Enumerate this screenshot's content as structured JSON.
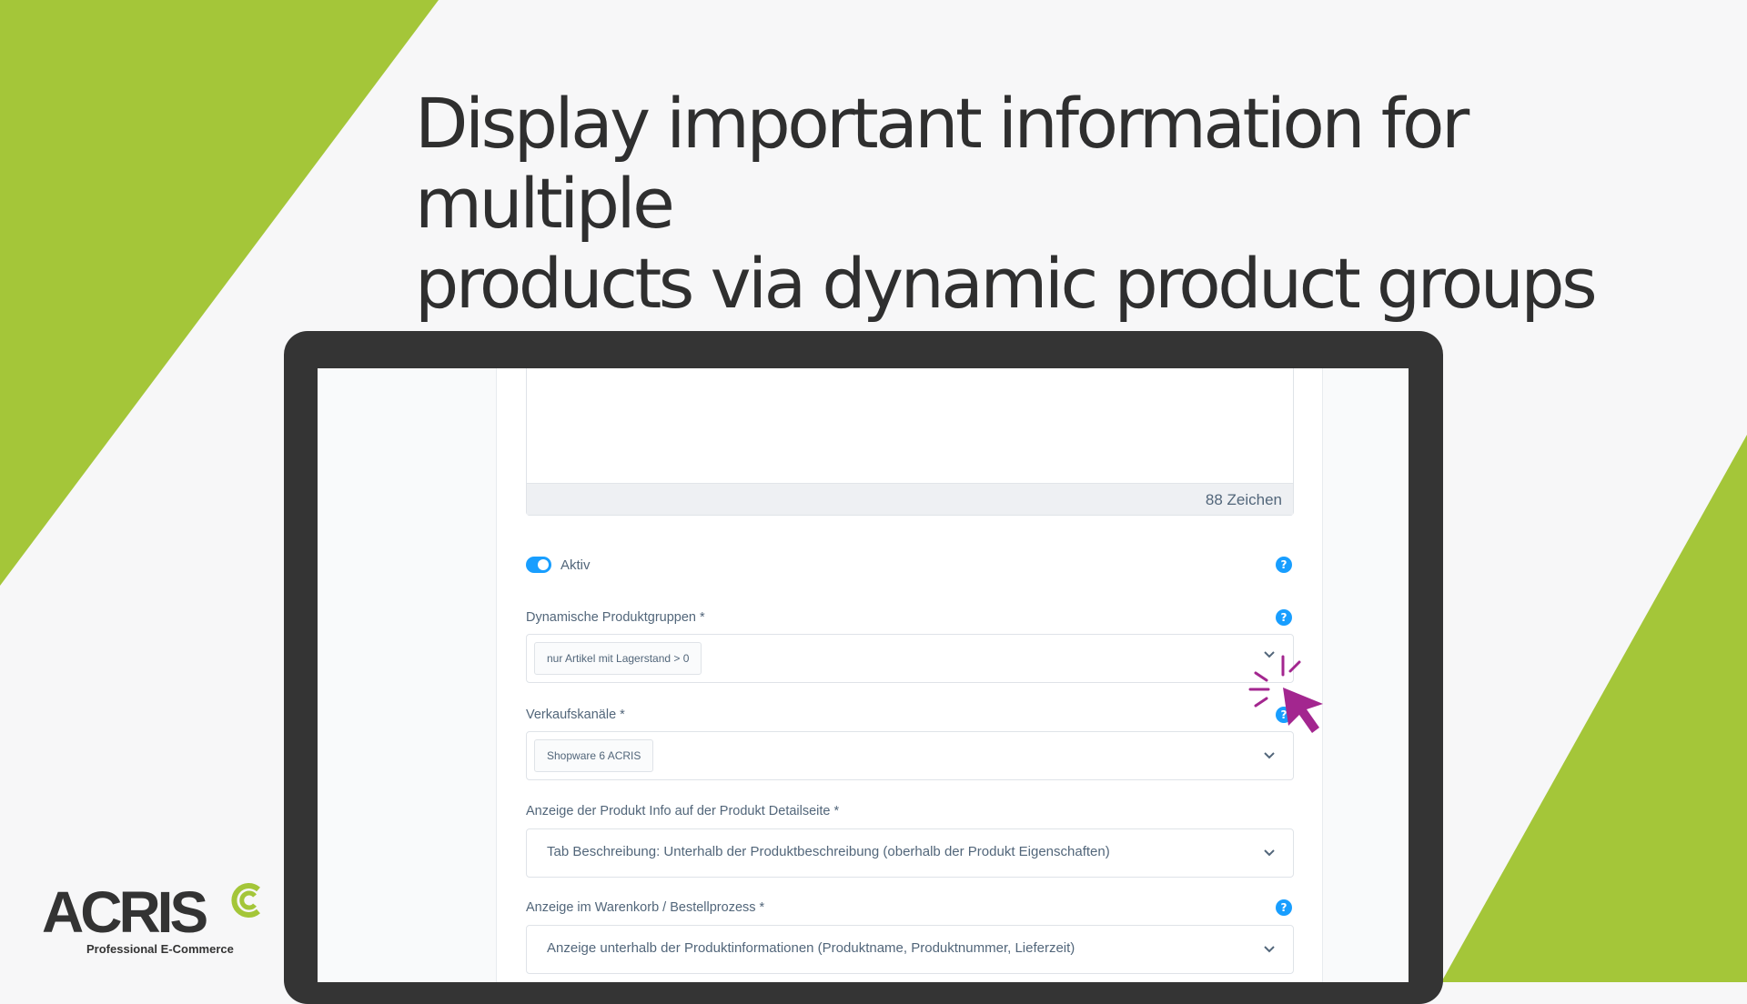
{
  "headline": {
    "line1": "Display important information for multiple",
    "line2": "products via dynamic product groups"
  },
  "colors": {
    "accent_green": "#a4c639",
    "toggle_blue": "#189eff",
    "cursor_magenta": "#a3268f"
  },
  "form": {
    "char_count": "88 Zeichen",
    "active_label": "Aktiv",
    "active_on": true,
    "product_groups": {
      "label": "Dynamische Produktgruppen *",
      "tag": "nur Artikel mit Lagerstand > 0"
    },
    "sales_channels": {
      "label": "Verkaufskanäle *",
      "tag": "Shopware 6 ACRIS"
    },
    "detail_display": {
      "label": "Anzeige der Produkt Info auf der Produkt Detailseite *",
      "value": "Tab Beschreibung: Unterhalb der Produktbeschreibung (oberhalb der Produkt Eigenschaften)"
    },
    "cart_display": {
      "label": "Anzeige im Warenkorb / Bestellprozess *",
      "value": "Anzeige unterhalb der Produktinformationen (Produktname, Produktnummer, Lieferzeit)"
    },
    "help_icon": "question-mark-icon",
    "chevron_icon": "chevron-down-icon"
  },
  "logo": {
    "text": "ACRIS",
    "tagline": "Professional E-Commerce"
  }
}
